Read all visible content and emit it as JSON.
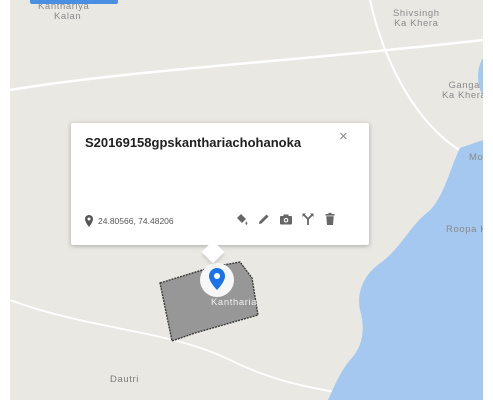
{
  "map": {
    "places": [
      {
        "id": "kanthariya-kalan",
        "lines": [
          "Kanthariya",
          "Kalan"
        ]
      },
      {
        "id": "shivsingh-ka-khera",
        "lines": [
          "Shivsingh",
          "Ka Khera"
        ]
      },
      {
        "id": "ganga-ka-khera",
        "lines": [
          "Ganga",
          "Ka Khera"
        ]
      },
      {
        "id": "kantharia",
        "lines": [
          "Kantharia"
        ]
      },
      {
        "id": "roopa",
        "lines": [
          "Roopa K"
        ]
      },
      {
        "id": "mo",
        "lines": [
          "Mo"
        ]
      },
      {
        "id": "dautri",
        "lines": [
          "Dautri"
        ]
      }
    ],
    "colors": {
      "land": "#e9e8e3",
      "water": "#a4c8f0",
      "road": "#ffffff",
      "polygon_fill": "#8e8e8e",
      "marker": "#1a73e8",
      "tab": "#4a90e2"
    }
  },
  "popup": {
    "title": "S20169158gpskanthariachohanoka",
    "coordinates": "24.80566, 74.48206",
    "close_label": "×",
    "tools": [
      "style-icon",
      "edit-icon",
      "camera-icon",
      "directions-icon",
      "delete-icon"
    ]
  }
}
